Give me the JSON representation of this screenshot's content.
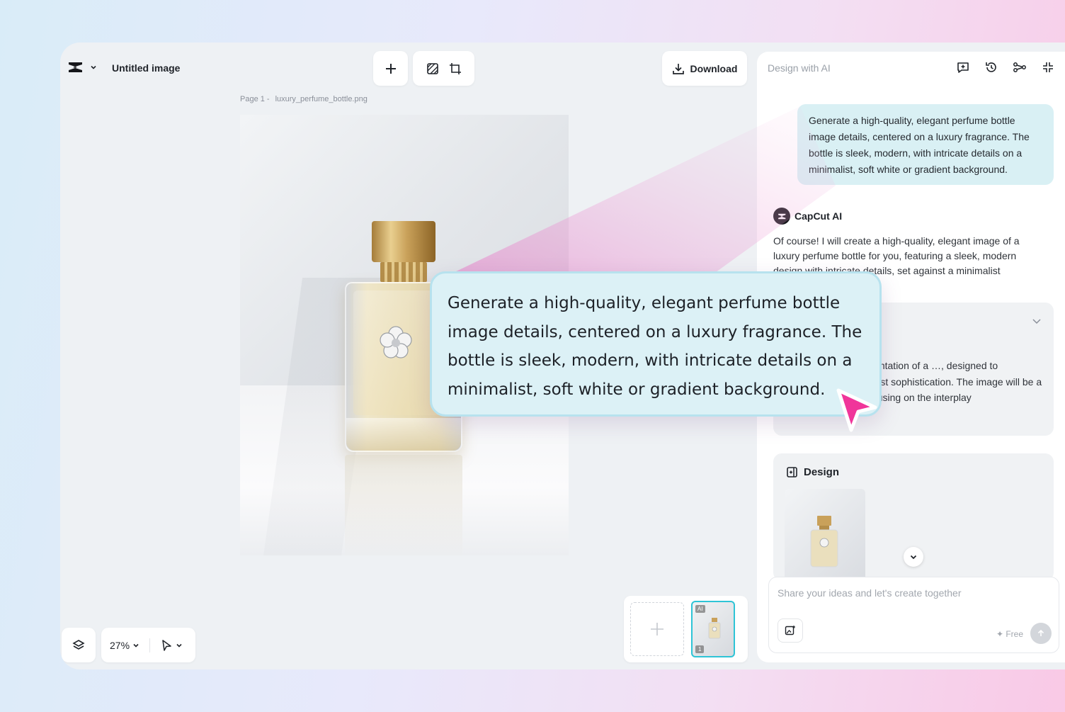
{
  "app": {
    "doc_title": "Untitled image",
    "download_label": "Download",
    "page_label_prefix": "Page 1 -",
    "page_file_name": "luxury_perfume_bottle.png",
    "zoom": "27%",
    "accent_color": "#2ec4d6"
  },
  "pages": {
    "thumb_ai_tag": "AI",
    "thumb_number": "1"
  },
  "ai_panel": {
    "title": "Design with AI",
    "user_prompt": "Generate a high-quality, elegant perfume bottle image details, centered on a luxury fragrance. The bottle is sleek, modern, with intricate details on a minimalist, soft white or gradient background.",
    "assistant_name": "CapCut AI",
    "assistant_reply": "Of course! I will create a high-quality, elegant image of a luxury perfume bottle for you, featuring a sleek, modern design with intricate details, set against a minimalist",
    "thought_text": "photorealistic representation of a …, designed to epitomize modern …list sophistication. The image will be a high-… …ct shot, focusing on the interplay",
    "design_label": "Design",
    "input_placeholder": "Share your ideas and let's create together",
    "free_label": "✦ Free"
  },
  "callout": {
    "text": "Generate a high-quality, elegant perfume bottle image details, centered on a luxury fragrance. The bottle is sleek, modern, with intricate details on a minimalist, soft white or gradient background.",
    "cursor_color": "#f0359a"
  }
}
